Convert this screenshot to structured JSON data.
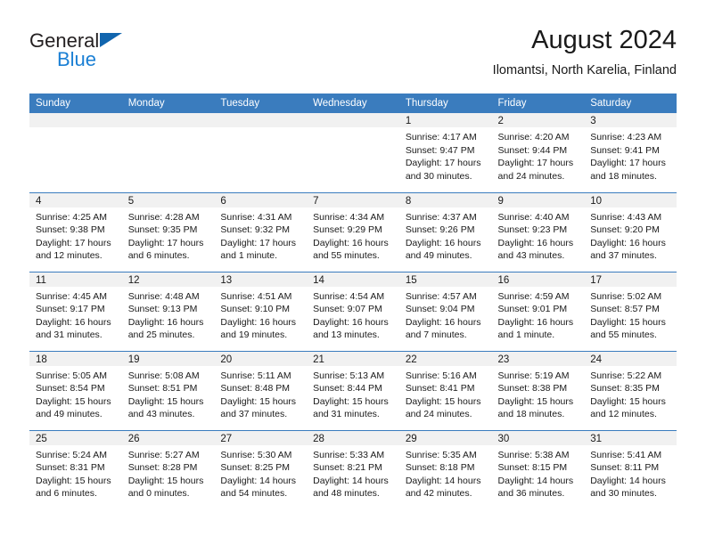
{
  "brand": {
    "name_top": "General",
    "name_bottom": "Blue",
    "triangle_color": "#1165ae",
    "blue_text_color": "#1a7fd4"
  },
  "header": {
    "title": "August 2024",
    "subtitle": "Ilomantsi, North Karelia, Finland"
  },
  "theme": {
    "header_row_bg": "#3a7cbe",
    "daynum_bg": "#f1f1f1",
    "grid_line": "#3a7cbe",
    "text": "#1a1a1a"
  },
  "weekdays": [
    "Sunday",
    "Monday",
    "Tuesday",
    "Wednesday",
    "Thursday",
    "Friday",
    "Saturday"
  ],
  "weeks": [
    [
      {
        "day": "",
        "sunrise": "",
        "sunset": "",
        "daylight": "",
        "empty": true
      },
      {
        "day": "",
        "sunrise": "",
        "sunset": "",
        "daylight": "",
        "empty": true
      },
      {
        "day": "",
        "sunrise": "",
        "sunset": "",
        "daylight": "",
        "empty": true
      },
      {
        "day": "",
        "sunrise": "",
        "sunset": "",
        "daylight": "",
        "empty": true
      },
      {
        "day": "1",
        "sunrise": "Sunrise: 4:17 AM",
        "sunset": "Sunset: 9:47 PM",
        "daylight": "Daylight: 17 hours and 30 minutes."
      },
      {
        "day": "2",
        "sunrise": "Sunrise: 4:20 AM",
        "sunset": "Sunset: 9:44 PM",
        "daylight": "Daylight: 17 hours and 24 minutes."
      },
      {
        "day": "3",
        "sunrise": "Sunrise: 4:23 AM",
        "sunset": "Sunset: 9:41 PM",
        "daylight": "Daylight: 17 hours and 18 minutes."
      }
    ],
    [
      {
        "day": "4",
        "sunrise": "Sunrise: 4:25 AM",
        "sunset": "Sunset: 9:38 PM",
        "daylight": "Daylight: 17 hours and 12 minutes."
      },
      {
        "day": "5",
        "sunrise": "Sunrise: 4:28 AM",
        "sunset": "Sunset: 9:35 PM",
        "daylight": "Daylight: 17 hours and 6 minutes."
      },
      {
        "day": "6",
        "sunrise": "Sunrise: 4:31 AM",
        "sunset": "Sunset: 9:32 PM",
        "daylight": "Daylight: 17 hours and 1 minute."
      },
      {
        "day": "7",
        "sunrise": "Sunrise: 4:34 AM",
        "sunset": "Sunset: 9:29 PM",
        "daylight": "Daylight: 16 hours and 55 minutes."
      },
      {
        "day": "8",
        "sunrise": "Sunrise: 4:37 AM",
        "sunset": "Sunset: 9:26 PM",
        "daylight": "Daylight: 16 hours and 49 minutes."
      },
      {
        "day": "9",
        "sunrise": "Sunrise: 4:40 AM",
        "sunset": "Sunset: 9:23 PM",
        "daylight": "Daylight: 16 hours and 43 minutes."
      },
      {
        "day": "10",
        "sunrise": "Sunrise: 4:43 AM",
        "sunset": "Sunset: 9:20 PM",
        "daylight": "Daylight: 16 hours and 37 minutes."
      }
    ],
    [
      {
        "day": "11",
        "sunrise": "Sunrise: 4:45 AM",
        "sunset": "Sunset: 9:17 PM",
        "daylight": "Daylight: 16 hours and 31 minutes."
      },
      {
        "day": "12",
        "sunrise": "Sunrise: 4:48 AM",
        "sunset": "Sunset: 9:13 PM",
        "daylight": "Daylight: 16 hours and 25 minutes."
      },
      {
        "day": "13",
        "sunrise": "Sunrise: 4:51 AM",
        "sunset": "Sunset: 9:10 PM",
        "daylight": "Daylight: 16 hours and 19 minutes."
      },
      {
        "day": "14",
        "sunrise": "Sunrise: 4:54 AM",
        "sunset": "Sunset: 9:07 PM",
        "daylight": "Daylight: 16 hours and 13 minutes."
      },
      {
        "day": "15",
        "sunrise": "Sunrise: 4:57 AM",
        "sunset": "Sunset: 9:04 PM",
        "daylight": "Daylight: 16 hours and 7 minutes."
      },
      {
        "day": "16",
        "sunrise": "Sunrise: 4:59 AM",
        "sunset": "Sunset: 9:01 PM",
        "daylight": "Daylight: 16 hours and 1 minute."
      },
      {
        "day": "17",
        "sunrise": "Sunrise: 5:02 AM",
        "sunset": "Sunset: 8:57 PM",
        "daylight": "Daylight: 15 hours and 55 minutes."
      }
    ],
    [
      {
        "day": "18",
        "sunrise": "Sunrise: 5:05 AM",
        "sunset": "Sunset: 8:54 PM",
        "daylight": "Daylight: 15 hours and 49 minutes."
      },
      {
        "day": "19",
        "sunrise": "Sunrise: 5:08 AM",
        "sunset": "Sunset: 8:51 PM",
        "daylight": "Daylight: 15 hours and 43 minutes."
      },
      {
        "day": "20",
        "sunrise": "Sunrise: 5:11 AM",
        "sunset": "Sunset: 8:48 PM",
        "daylight": "Daylight: 15 hours and 37 minutes."
      },
      {
        "day": "21",
        "sunrise": "Sunrise: 5:13 AM",
        "sunset": "Sunset: 8:44 PM",
        "daylight": "Daylight: 15 hours and 31 minutes."
      },
      {
        "day": "22",
        "sunrise": "Sunrise: 5:16 AM",
        "sunset": "Sunset: 8:41 PM",
        "daylight": "Daylight: 15 hours and 24 minutes."
      },
      {
        "day": "23",
        "sunrise": "Sunrise: 5:19 AM",
        "sunset": "Sunset: 8:38 PM",
        "daylight": "Daylight: 15 hours and 18 minutes."
      },
      {
        "day": "24",
        "sunrise": "Sunrise: 5:22 AM",
        "sunset": "Sunset: 8:35 PM",
        "daylight": "Daylight: 15 hours and 12 minutes."
      }
    ],
    [
      {
        "day": "25",
        "sunrise": "Sunrise: 5:24 AM",
        "sunset": "Sunset: 8:31 PM",
        "daylight": "Daylight: 15 hours and 6 minutes."
      },
      {
        "day": "26",
        "sunrise": "Sunrise: 5:27 AM",
        "sunset": "Sunset: 8:28 PM",
        "daylight": "Daylight: 15 hours and 0 minutes."
      },
      {
        "day": "27",
        "sunrise": "Sunrise: 5:30 AM",
        "sunset": "Sunset: 8:25 PM",
        "daylight": "Daylight: 14 hours and 54 minutes."
      },
      {
        "day": "28",
        "sunrise": "Sunrise: 5:33 AM",
        "sunset": "Sunset: 8:21 PM",
        "daylight": "Daylight: 14 hours and 48 minutes."
      },
      {
        "day": "29",
        "sunrise": "Sunrise: 5:35 AM",
        "sunset": "Sunset: 8:18 PM",
        "daylight": "Daylight: 14 hours and 42 minutes."
      },
      {
        "day": "30",
        "sunrise": "Sunrise: 5:38 AM",
        "sunset": "Sunset: 8:15 PM",
        "daylight": "Daylight: 14 hours and 36 minutes."
      },
      {
        "day": "31",
        "sunrise": "Sunrise: 5:41 AM",
        "sunset": "Sunset: 8:11 PM",
        "daylight": "Daylight: 14 hours and 30 minutes."
      }
    ]
  ]
}
